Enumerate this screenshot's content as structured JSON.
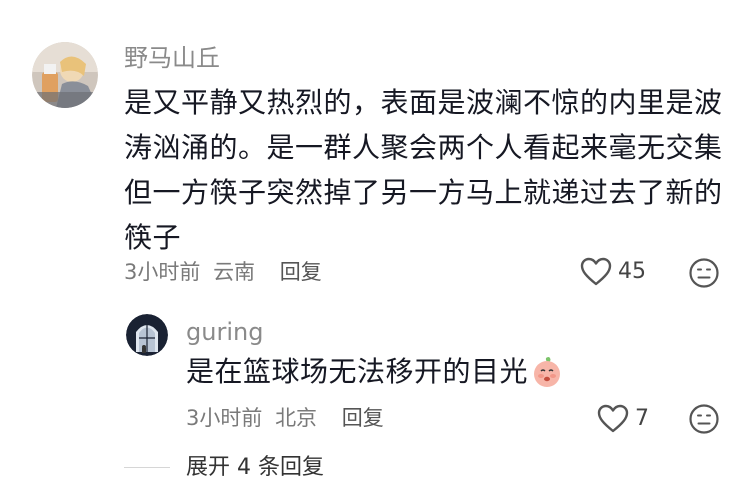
{
  "comment": {
    "username": "野马山丘",
    "lines": [
      "是又平静又热烈的，表面是波澜不惊的内里是波",
      "涛汹涌的。是一群人聚会两个人看起来毫无交集",
      "但一方筷子突然掉了另一方马上就递过去了新的",
      "筷子"
    ],
    "time": "3小时前",
    "location": "云南",
    "reply_label": "回复",
    "likes": "45"
  },
  "sub_reply": {
    "username": "guring",
    "text": "是在篮球场无法移开的目光",
    "time": "3小时前",
    "location": "北京",
    "reply_label": "回复",
    "likes": "7"
  },
  "expand": {
    "label": "展开 4 条回复"
  },
  "icons": {
    "like": "heart-outline-icon",
    "dislike": "meh-face-icon",
    "emoji": "peach-face-emoji"
  },
  "colors": {
    "text": "#161823",
    "secondary": "#8a8a8a",
    "icon": "#555555"
  }
}
